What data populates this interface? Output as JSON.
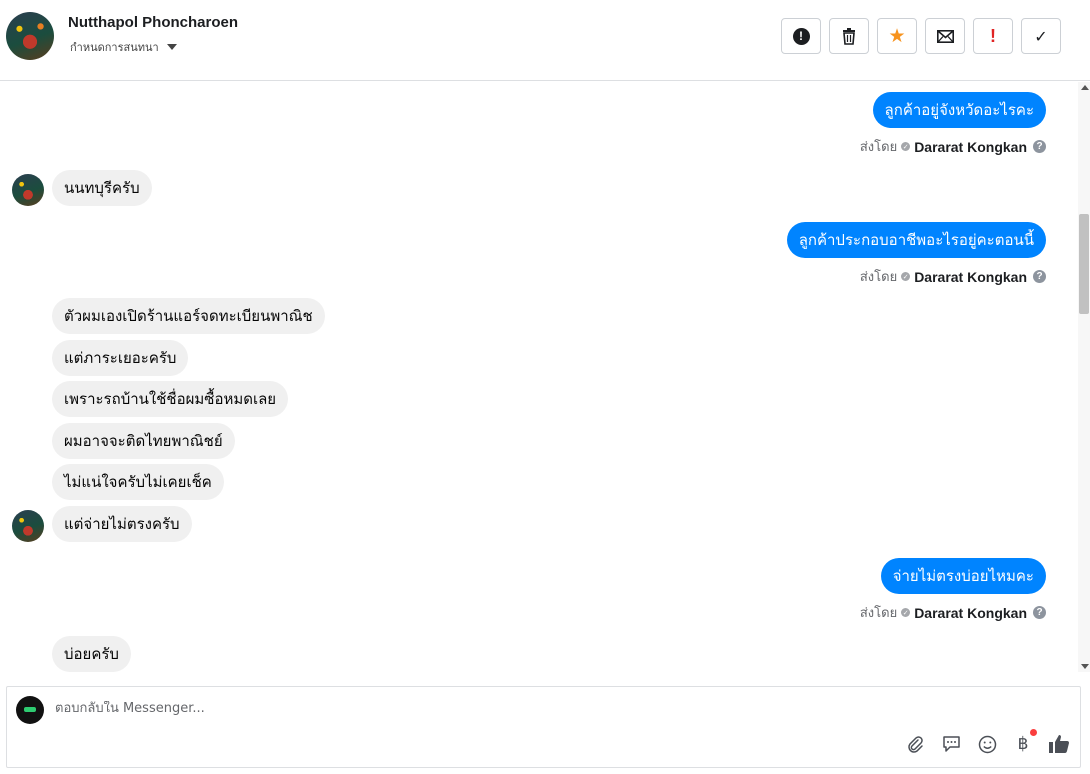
{
  "header": {
    "contact_name": "Nutthapol Phoncharoen",
    "assign_label": "กำหนดการสนทนา",
    "toolbar": [
      {
        "name": "mark-spam-button",
        "icon": "alert-circle-icon"
      },
      {
        "name": "delete-button",
        "icon": "trash-icon",
        "glyph": "🗑"
      },
      {
        "name": "star-button",
        "icon": "star-icon",
        "glyph": "★"
      },
      {
        "name": "mark-unread-button",
        "icon": "envelope-icon",
        "glyph": "✉"
      },
      {
        "name": "mark-urgent-button",
        "icon": "exclamation-icon",
        "glyph": "!"
      },
      {
        "name": "mark-done-button",
        "icon": "check-icon",
        "glyph": "✓"
      }
    ]
  },
  "messages": {
    "m1": "ลูกค้าอยู่จังหวัดอะไรคะ",
    "m2": "นนทบุรีครับ",
    "m3": "ลูกค้าประกอบอาชีพอะไรอยู่คะตอนนี้",
    "m4": "ตัวผมเองเปิดร้านแอร์จดทะเบียนพาณิช",
    "m5": "แต่ภาระเยอะครับ",
    "m6": "เพราะรถบ้านใช้ชื่อผมซื้อหมดเลย",
    "m7": "ผมอาจจะติดไทยพาณิชย์",
    "m8": "ไม่แน่ใจครับไม่เคยเช็ค",
    "m9": "แต่จ่ายไม่ตรงครับ",
    "m10": "จ่ายไม่ตรงบ่อยไหมคะ",
    "m11": "บ่อยครับ"
  },
  "sent_by": {
    "label": "ส่งโดย",
    "agent": "Dararat Kongkan",
    "help_glyph": "?"
  },
  "composer": {
    "placeholder": "ตอบกลับใน Messenger...",
    "tools": [
      {
        "name": "attach-icon",
        "glyph": "📎"
      },
      {
        "name": "saved-replies-icon",
        "glyph": "💬"
      },
      {
        "name": "emoji-icon",
        "glyph": "☺"
      },
      {
        "name": "payment-icon",
        "glyph": "฿"
      },
      {
        "name": "like-icon",
        "glyph": "👍"
      }
    ]
  },
  "colors": {
    "outgoing_bubble": "#0084ff",
    "incoming_bubble": "#f0f0f0",
    "star": "#f7931e",
    "urgent": "#e02424"
  }
}
